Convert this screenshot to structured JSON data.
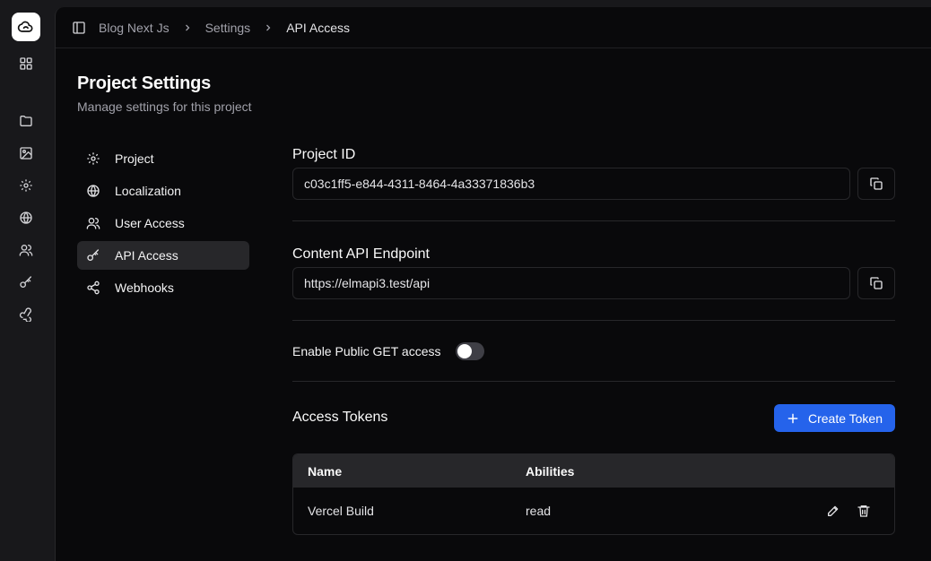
{
  "breadcrumb": {
    "project": "Blog Next Js",
    "section": "Settings",
    "current": "API Access"
  },
  "page": {
    "title": "Project Settings",
    "subtitle": "Manage settings for this project"
  },
  "rail": {
    "icons": [
      "logo-icon",
      "dashboard-grid-icon",
      "folder-icon",
      "image-icon",
      "gear-icon",
      "globe-icon",
      "users-icon",
      "key-icon",
      "webhook-icon"
    ]
  },
  "settings_nav": {
    "items": [
      {
        "label": "Project",
        "icon": "gear-icon"
      },
      {
        "label": "Localization",
        "icon": "globe-icon"
      },
      {
        "label": "User Access",
        "icon": "users-icon"
      },
      {
        "label": "API Access",
        "icon": "key-icon",
        "active": true
      },
      {
        "label": "Webhooks",
        "icon": "share-icon"
      }
    ]
  },
  "project_id": {
    "label": "Project ID",
    "value": "c03c1ff5-e844-4311-8464-4a33371836b3"
  },
  "endpoint": {
    "label": "Content API Endpoint",
    "value": "https://elmapi3.test/api"
  },
  "public_get": {
    "label": "Enable Public GET access",
    "enabled": false
  },
  "tokens": {
    "title": "Access Tokens",
    "create_label": "Create Token",
    "columns": [
      "Name",
      "Abilities"
    ],
    "rows": [
      {
        "name": "Vercel Build",
        "abilities": "read"
      }
    ]
  },
  "colors": {
    "accent": "#2563eb",
    "background": "#09090b",
    "rail": "#18181b"
  }
}
